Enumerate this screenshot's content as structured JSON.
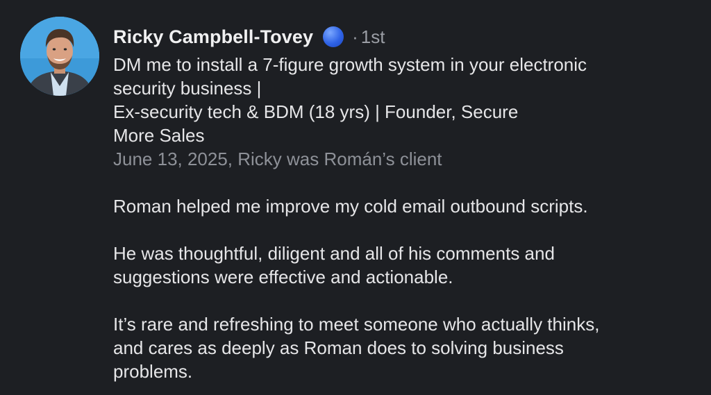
{
  "profile": {
    "name": "Ricky Campbell-Tovey",
    "badge_icon": "verified-badge-icon",
    "degree_separator": "·",
    "degree": "1st",
    "headline_lines": [
      "DM me to install a 7-figure growth system in your electronic",
      "security business |",
      "Ex-security tech & BDM (18 yrs) | Founder, Secure",
      "More Sales"
    ],
    "meta": "June 13, 2025, Ricky was Román’s client",
    "avatar_icon": "profile-photo"
  },
  "recommendation": {
    "paragraphs": [
      [
        "Roman helped me improve my cold email outbound scripts."
      ],
      [
        "He was thoughtful, diligent and all of his comments and",
        "suggestions were effective and actionable."
      ],
      [
        "It’s rare and refreshing to meet someone who actually thinks,",
        "and cares as deeply as Roman does to solving business",
        "problems."
      ]
    ]
  },
  "colors": {
    "background": "#1d1f23",
    "text": "#e6e6e8",
    "muted": "#8e9198",
    "badge": "#2f63e6"
  }
}
